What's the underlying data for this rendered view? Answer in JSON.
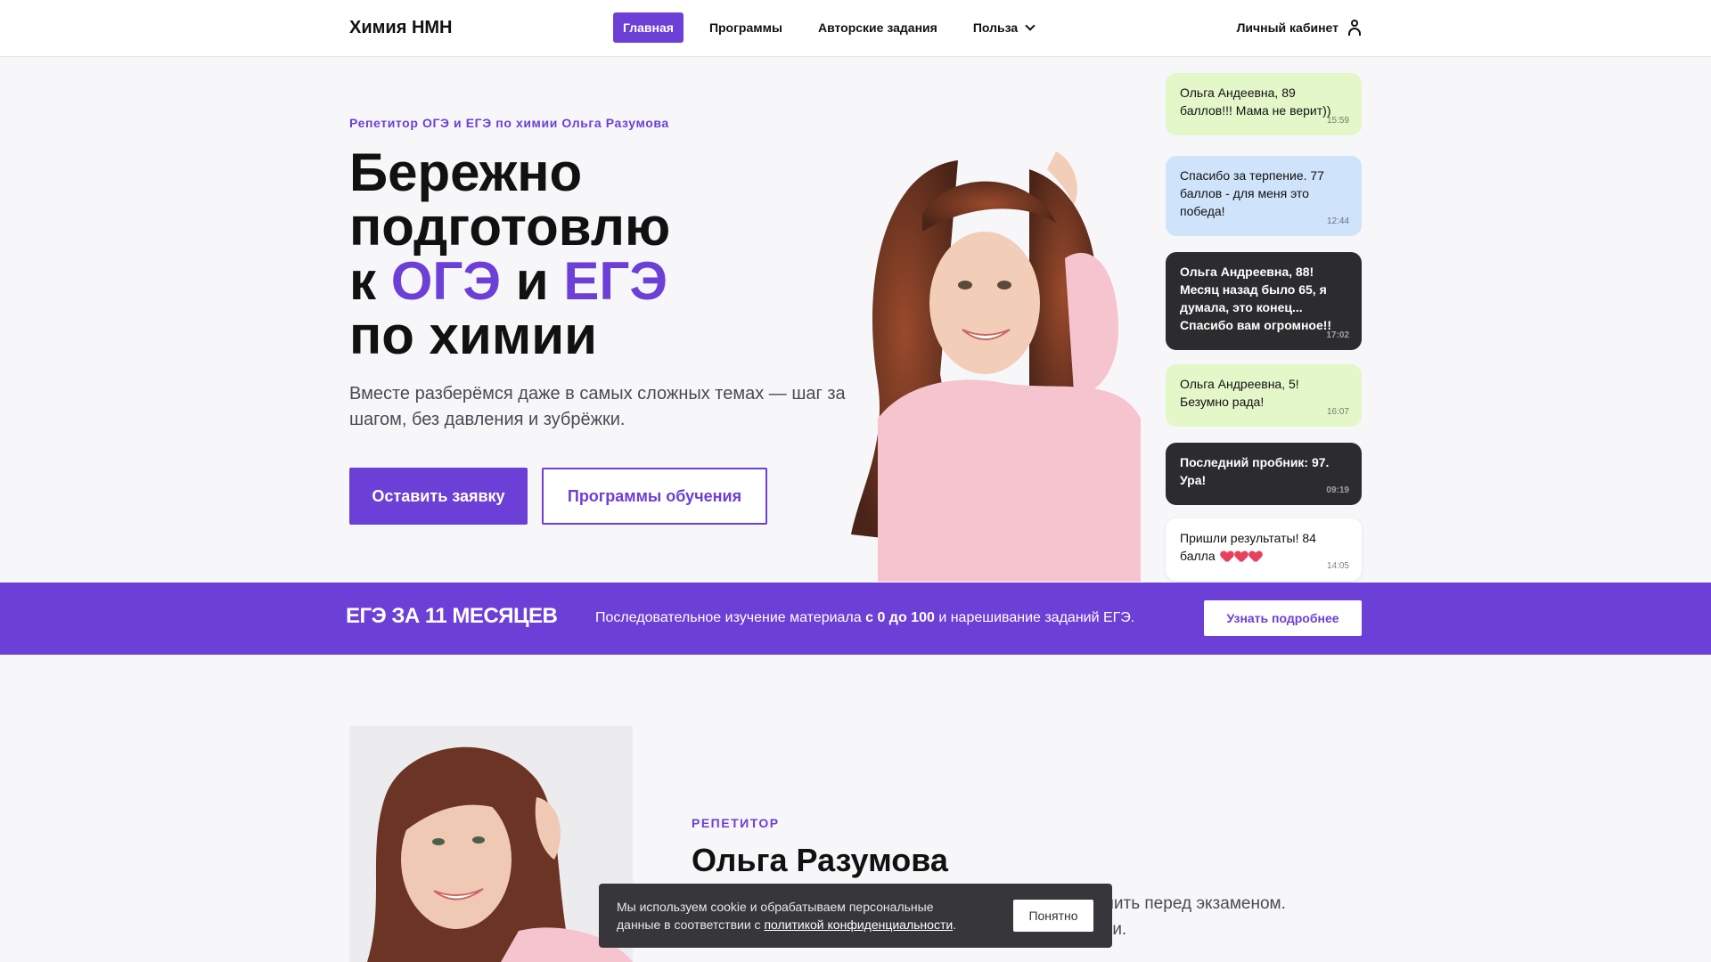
{
  "header": {
    "logo": "Химия НМН",
    "nav": [
      {
        "label": "Главная"
      },
      {
        "label": "Программы"
      },
      {
        "label": "Авторские задания"
      },
      {
        "label": "Польза"
      }
    ],
    "account_label": "Личный кабинет"
  },
  "hero": {
    "tagline": "Репетитор ОГЭ и ЕГЭ по химии Ольга Разумова",
    "title_line1": "Бережно",
    "title_line2": "подготовлю",
    "title_k": "к",
    "title_oge": "ОГЭ",
    "title_and": "и",
    "title_ege": "ЕГЭ",
    "title_line4": "по химии",
    "subtitle": "Вместе разберёмся даже в самых сложных темах — шаг за шагом, без давления и зубрёжки.",
    "btn_primary": "Оставить заявку",
    "btn_secondary": "Программы обучения"
  },
  "chat": [
    {
      "text": "Ольга Андеевна, 89 баллов!!! Мама не верит))",
      "time": "15:59"
    },
    {
      "text": "Спасибо за терпение. 77 баллов - для меня это победа!",
      "time": "12:44"
    },
    {
      "text": "Ольга Андреевна, 88! Месяц назад было 65, я думала, это конец... Спасибо вам огромное!!",
      "time": "17:02"
    },
    {
      "text": "Ольга Андреевна, 5! Безумно рада!",
      "time": "16:07"
    },
    {
      "text": "Последний пробник: 97. Ура!",
      "time": "09:19"
    },
    {
      "text": "Пришли результаты! 84 балла",
      "time": "14:05"
    }
  ],
  "banner": {
    "title": "ЕГЭ ЗА 11 МЕСЯЦЕВ",
    "text_before": "Последовательное изучение материала ",
    "text_bold": "с 0 до 100",
    "text_after": " и нарешивание заданий ЕГЭ.",
    "button": "Узнать подробнее"
  },
  "tutor": {
    "tag": "РЕПЕТИТОР",
    "name": "Ольга Разумова",
    "text_line1": "чить перед экзаменом.",
    "text_line2": "ки."
  },
  "cookie": {
    "text_line1": "Мы используем cookie и обрабатываем персональные",
    "text_line2_before": "данные в соответствии с ",
    "link": "политикой конфиденциальности",
    "text_line2_after": ".",
    "button": "Понятно"
  },
  "colors": {
    "accent": "#6c3fd6",
    "bubble_green": "#e4f7c9",
    "bubble_blue": "#cfe3fb",
    "bubble_dark": "#2c2c2f"
  }
}
